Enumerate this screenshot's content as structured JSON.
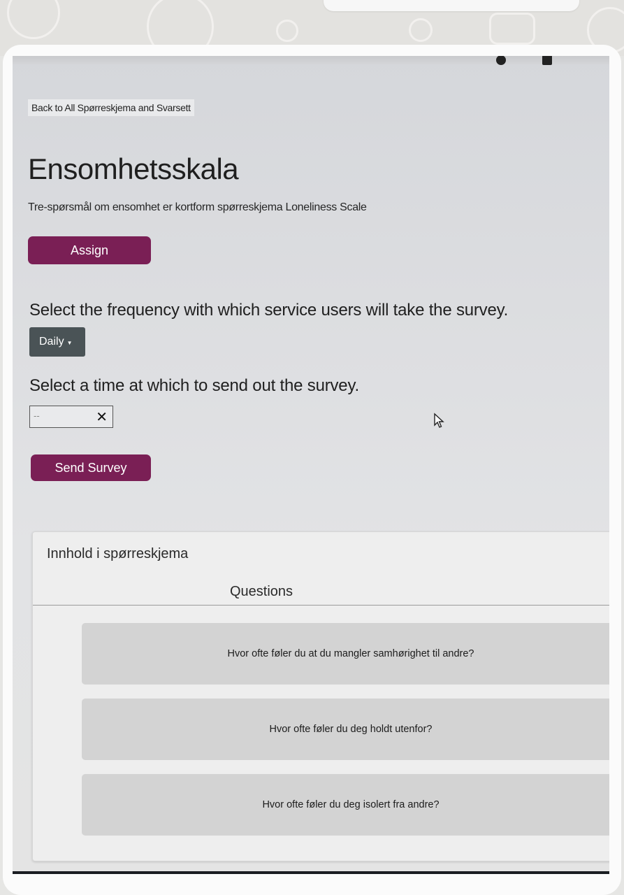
{
  "page": {
    "back_link": "Back to All Spørreskjema and Svarsett",
    "title": "Ensomhetsskala",
    "subtitle": "Tre-spørsmål om ensomhet er kortform spørreskjema Loneliness Scale"
  },
  "actions": {
    "assign_label": "Assign",
    "send_label": "Send Survey"
  },
  "schedule": {
    "frequency_label": "Select the frequency with which service users will take the survey.",
    "frequency_value": "Daily",
    "time_label": "Select a time at which to send out the survey.",
    "time_value": "--",
    "clear_glyph": "✕"
  },
  "contents": {
    "heading": "Innhold i spørreskjema",
    "column_header": "Questions",
    "questions": [
      "Hvor ofte føler du at du mangler samhørighet til andre?",
      "Hvor ofte føler du deg holdt utenfor?",
      "Hvor ofte føler du deg isolert fra andre?"
    ]
  },
  "colors": {
    "accent": "#7a1f55",
    "dropdown": "#4a5356",
    "question_card": "#d3d3d3"
  },
  "taskbar": {
    "icons": [
      "chrome-icon",
      "teams-chat-icon",
      "word-icon",
      "teams-icon",
      "excel-icon"
    ]
  }
}
